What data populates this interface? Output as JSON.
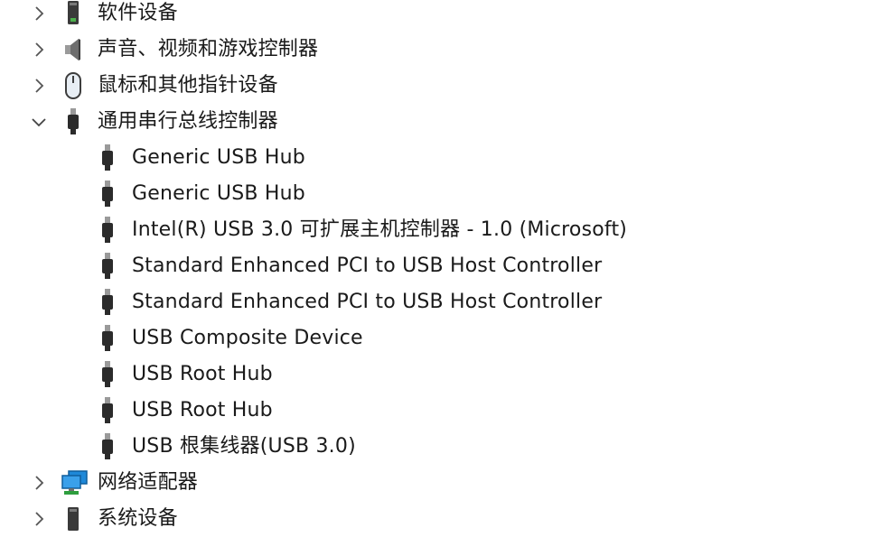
{
  "device_tree": {
    "categories": {
      "software": {
        "label": "软件设备",
        "icon": "software-device-icon",
        "expanded": false
      },
      "audio": {
        "label": "声音、视频和游戏控制器",
        "icon": "speaker-icon",
        "expanded": false
      },
      "mouse": {
        "label": "鼠标和其他指针设备",
        "icon": "mouse-icon",
        "expanded": false
      },
      "usb": {
        "label": "通用串行总线控制器",
        "icon": "usb-plug-icon",
        "expanded": true
      },
      "network": {
        "label": "网络适配器",
        "icon": "network-monitor-icon",
        "expanded": false
      },
      "system": {
        "label": "系统设备",
        "icon": "system-device-icon",
        "expanded": false
      }
    },
    "usb_devices": [
      {
        "label": "Generic USB Hub",
        "icon": "usb-plug-icon"
      },
      {
        "label": "Generic USB Hub",
        "icon": "usb-plug-icon"
      },
      {
        "label": "Intel(R) USB 3.0 可扩展主机控制器 - 1.0 (Microsoft)",
        "icon": "usb-plug-icon"
      },
      {
        "label": "Standard Enhanced PCI to USB Host Controller",
        "icon": "usb-plug-icon"
      },
      {
        "label": "Standard Enhanced PCI to USB Host Controller",
        "icon": "usb-plug-icon"
      },
      {
        "label": "USB Composite Device",
        "icon": "usb-plug-icon"
      },
      {
        "label": "USB Root Hub",
        "icon": "usb-plug-icon"
      },
      {
        "label": "USB Root Hub",
        "icon": "usb-plug-icon"
      },
      {
        "label": "USB 根集线器(USB 3.0)",
        "icon": "usb-plug-icon"
      }
    ]
  },
  "colors": {
    "text": "#1a1a1a",
    "chevron": "#555555",
    "usb_icon_dark": "#2b2b2b",
    "usb_icon_light": "#9a9a9a",
    "network_blue": "#1e88d8",
    "network_green": "#2e9e3e"
  }
}
